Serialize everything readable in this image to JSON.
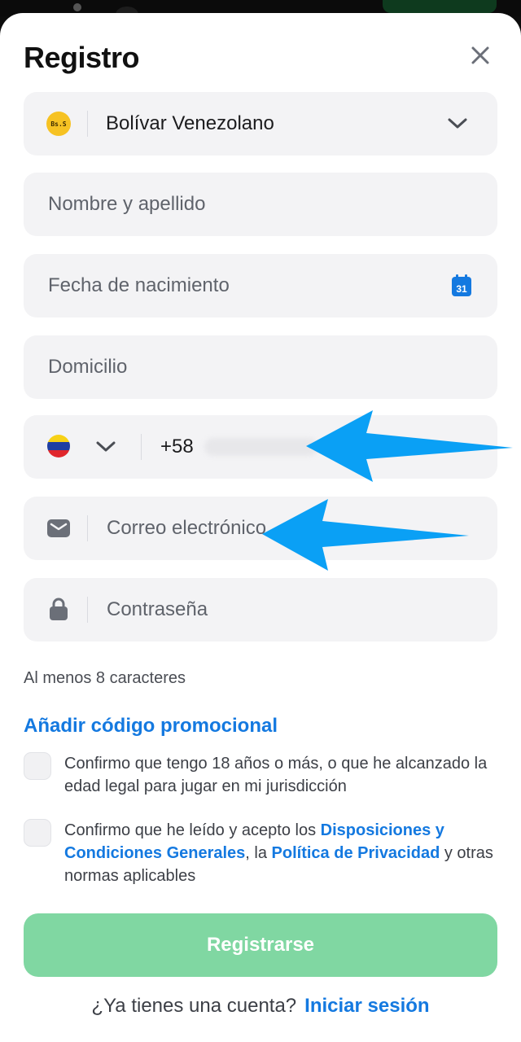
{
  "header": {
    "title": "Registro"
  },
  "currency": {
    "badge": "Bs.S",
    "label": "Bolívar Venezolano"
  },
  "fields": {
    "name_placeholder": "Nombre y apellido",
    "birthdate_placeholder": "Fecha de nacimiento",
    "calendar_day": "31",
    "address_placeholder": "Domicilio",
    "phone_code": "+58",
    "email_placeholder": "Correo electrónico",
    "password_placeholder": "Contraseña"
  },
  "password_hint": "Al menos 8 caracteres",
  "promo_link": "Añadir código promocional",
  "checks": {
    "age": "Confirmo que tengo 18 años o más, o que he alcanzado la edad legal para jugar en mi jurisdicción",
    "terms_prefix": "Confirmo que he leído y acepto los ",
    "terms_link": "Disposiciones y Condiciones Generales",
    "terms_mid": ", la ",
    "privacy_link": "Política de Privacidad",
    "terms_suffix": " y otras normas aplicables"
  },
  "submit_label": "Registrarse",
  "footer": {
    "question": "¿Ya tienes una cuenta?",
    "login_link": "Iniciar sesión"
  },
  "colors": {
    "accent": "#1479e0",
    "submit_bg": "#80d7a2",
    "field_bg": "#f3f3f5",
    "annotation_arrow": "#0aa0f5"
  },
  "icons": {
    "close": "close-icon",
    "chevron": "chevron-down-icon",
    "calendar": "calendar-icon",
    "mail": "mail-icon",
    "lock": "lock-icon",
    "flag": "venezuela-flag-icon"
  }
}
